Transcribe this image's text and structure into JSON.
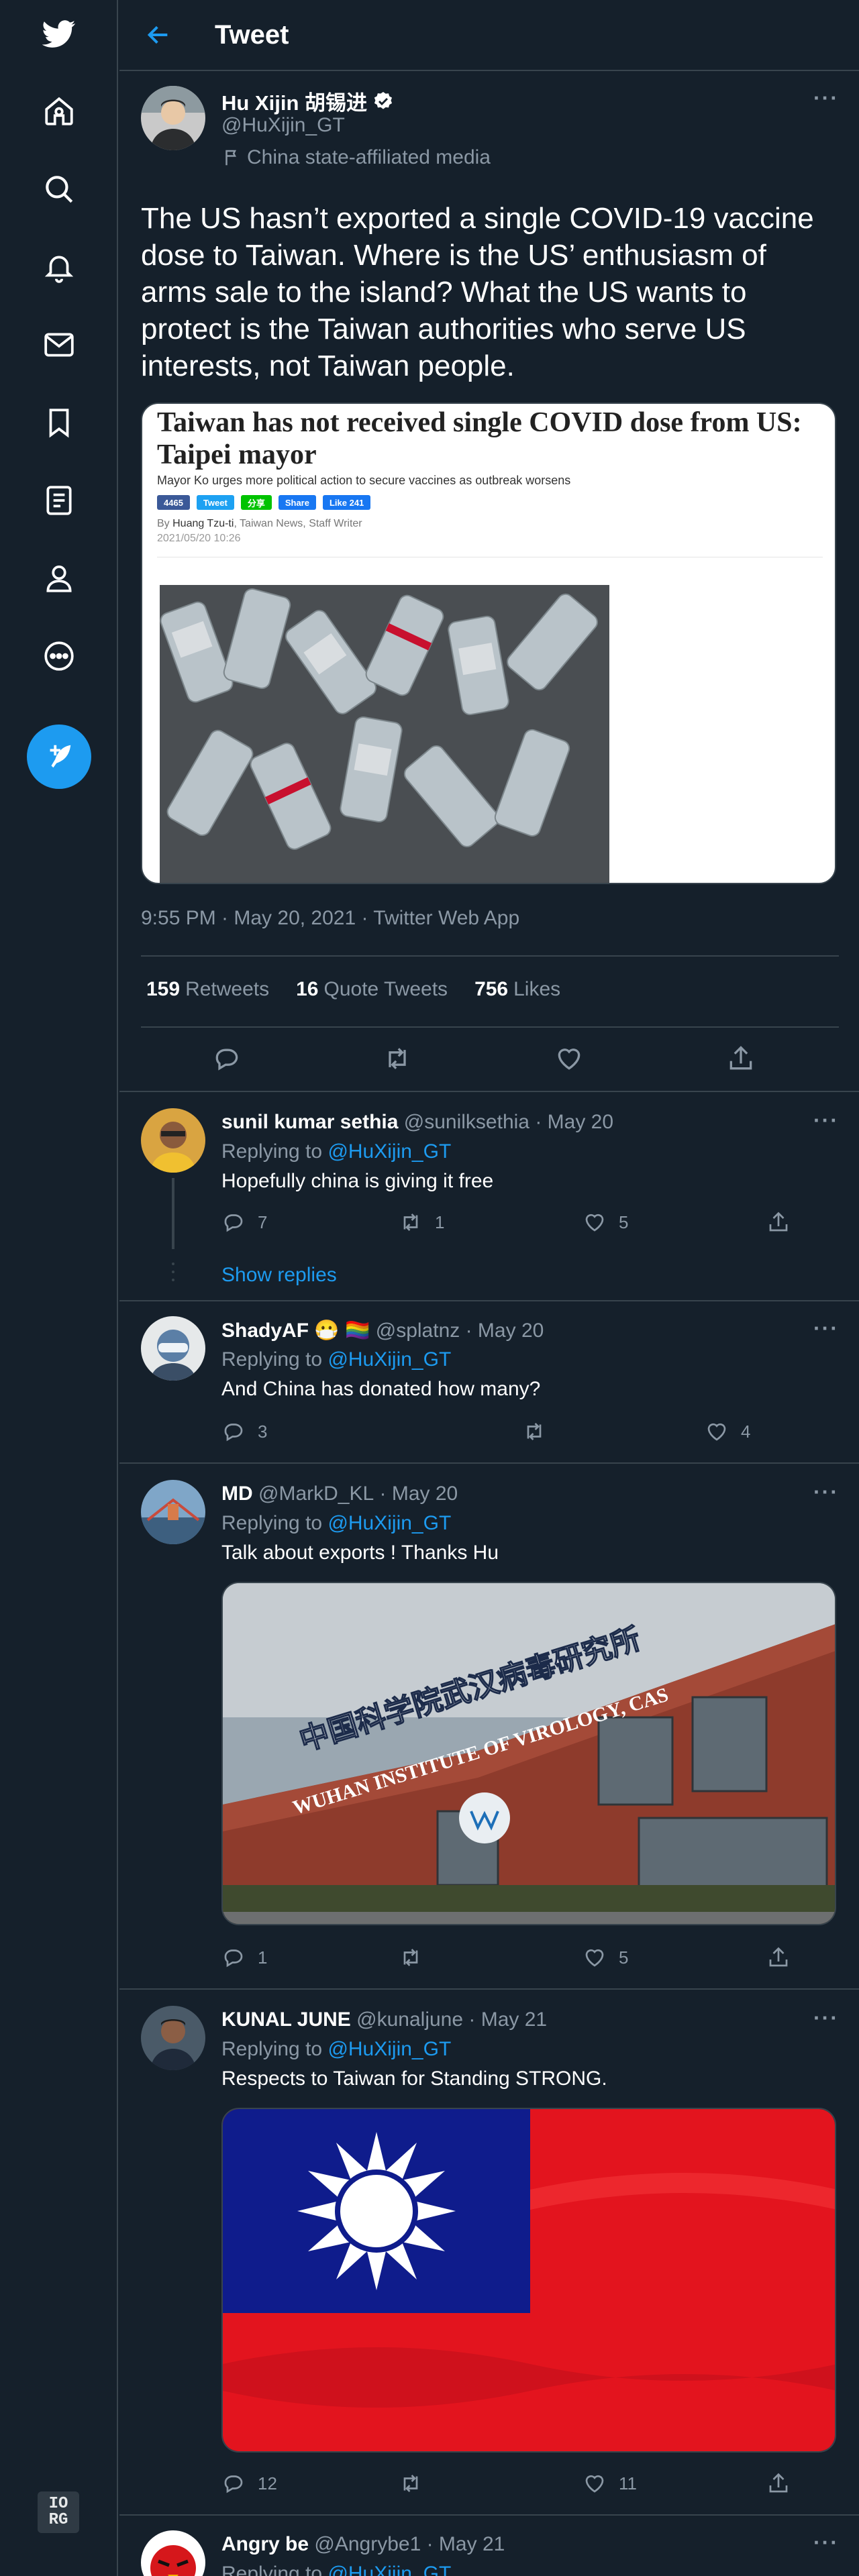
{
  "header": {
    "title": "Tweet"
  },
  "sidebar": {
    "items": [
      "home",
      "explore",
      "notifications",
      "messages",
      "bookmarks",
      "lists",
      "profile",
      "more"
    ],
    "account_chip_line1": "IO",
    "account_chip_line2": "RG"
  },
  "tweet": {
    "author_name": "Hu Xijin 胡锡进",
    "author_handle": "@HuXijin_GT",
    "label": "China state-affiliated media",
    "text": "The US hasn’t exported a single COVID-19 vaccine dose to Taiwan. Where is the US’ enthusiasm of arms sale to the island? What the US wants to protect is the Taiwan authorities who serve US interests, not Taiwan people.",
    "timestamp": "9:55 PM · May 20, 2021 · Twitter Web App",
    "retweets": "159",
    "retweets_label": "Retweets",
    "quotes": "16",
    "quotes_label": "Quote Tweets",
    "likes": "756",
    "likes_label": "Likes"
  },
  "card": {
    "headline": "Taiwan has not received single COVID dose from US: Taipei mayor",
    "subhead": "Mayor Ko urges more political action to secure vaccines as outbreak worsens",
    "share": {
      "count": "4465",
      "tweet": "Tweet",
      "line": "分享",
      "share": "Share",
      "like": "Like 241"
    },
    "byline_prefix": "By",
    "byline_author": "Huang Tzu-ti",
    "byline_suffix": ", Taiwan News, Staff Writer",
    "date": "2021/05/20 10:26"
  },
  "replies": [
    {
      "name": "sunil kumar sethia",
      "handle": "@sunilksethia",
      "date": "· May 20",
      "replying_prefix": "Replying to",
      "replying_to": "@HuXijin_GT",
      "text": "Hopefully china is giving it free",
      "replies": "7",
      "retweets": "1",
      "likes": "5",
      "show_replies": "Show replies"
    },
    {
      "name": "ShadyAF 😷 🏳️‍🌈",
      "handle": "@splatnz",
      "date": "· May 20",
      "replying_prefix": "Replying to",
      "replying_to": "@HuXijin_GT",
      "text": "And China has donated how many?",
      "replies": "3",
      "retweets": "",
      "likes": "4"
    },
    {
      "name": "MD",
      "handle": "@MarkD_KL",
      "date": "· May 20",
      "replying_prefix": "Replying to",
      "replying_to": "@HuXijin_GT",
      "text": "Talk about exports ! Thanks Hu",
      "replies": "1",
      "retweets": "",
      "likes": "5",
      "media_sign_en": "WUHAN INSTITUTE OF VIROLOGY, CAS",
      "media_sign_cn": "中国科学院武汉病毒研究所"
    },
    {
      "name": "KUNAL JUNE",
      "handle": "@kunaljune",
      "date": "· May 21",
      "replying_prefix": "Replying to",
      "replying_to": "@HuXijin_GT",
      "text": "Respects to Taiwan for Standing STRONG.",
      "replies": "12",
      "retweets": "",
      "likes": "11"
    },
    {
      "name": "Angry be",
      "handle": "@Angrybe1",
      "date": "· May 21",
      "replying_prefix": "Replying to",
      "replying_to": "@HuXijin_GT"
    }
  ],
  "colors": {
    "background": "#15202b",
    "accent": "#1d9bf0",
    "border": "#38444d",
    "muted": "#8b98a5"
  }
}
